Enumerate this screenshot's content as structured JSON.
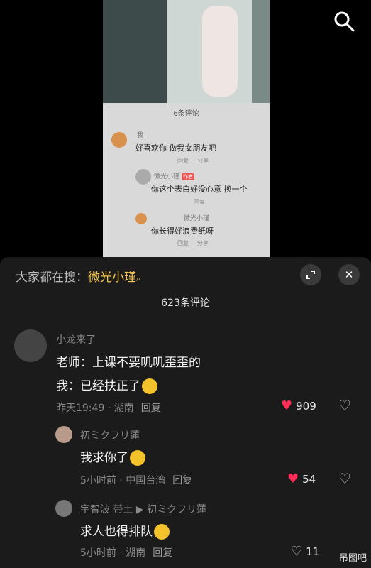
{
  "video": {
    "inner_comment_count": "6条评论",
    "inner_comments": [
      {
        "name": "我",
        "text": "好喜欢你 做我女朋友吧",
        "meta": [
          "回复",
          "分享"
        ]
      },
      {
        "name": "微光小瑾",
        "tag": "作者",
        "text": "你这个表白好没心意 换一个",
        "meta": [
          "回复"
        ]
      },
      {
        "name": "微光小瑾",
        "text": "你长得好浪费纸呀",
        "meta": [
          "回复",
          "分享"
        ]
      }
    ]
  },
  "panel": {
    "search_prefix": "大家都在搜：",
    "search_keyword": "微光小瑾",
    "comment_count": "623条评论",
    "comments": [
      {
        "user": "小龙来了",
        "line1": "老师：上课不要叽叽歪歪的",
        "line2": "我：已经扶正了",
        "time": "昨天19:49 · 湖南",
        "reply": "回复",
        "likes": "909"
      },
      {
        "user": "初ミクフリ蓮",
        "text": "我求你了",
        "time": "5小时前 · 中国台湾",
        "reply": "回复",
        "likes": "54"
      },
      {
        "user": "宇智波 带土 ▶ 初ミクフリ蓮",
        "text": "求人也得排队",
        "time": "5小时前 · 湖南",
        "reply": "回复",
        "likes": "11"
      }
    ],
    "watermark": "吊图吧"
  },
  "colors": {
    "keyword": "#f3c34f",
    "like": "#ff2d55"
  }
}
